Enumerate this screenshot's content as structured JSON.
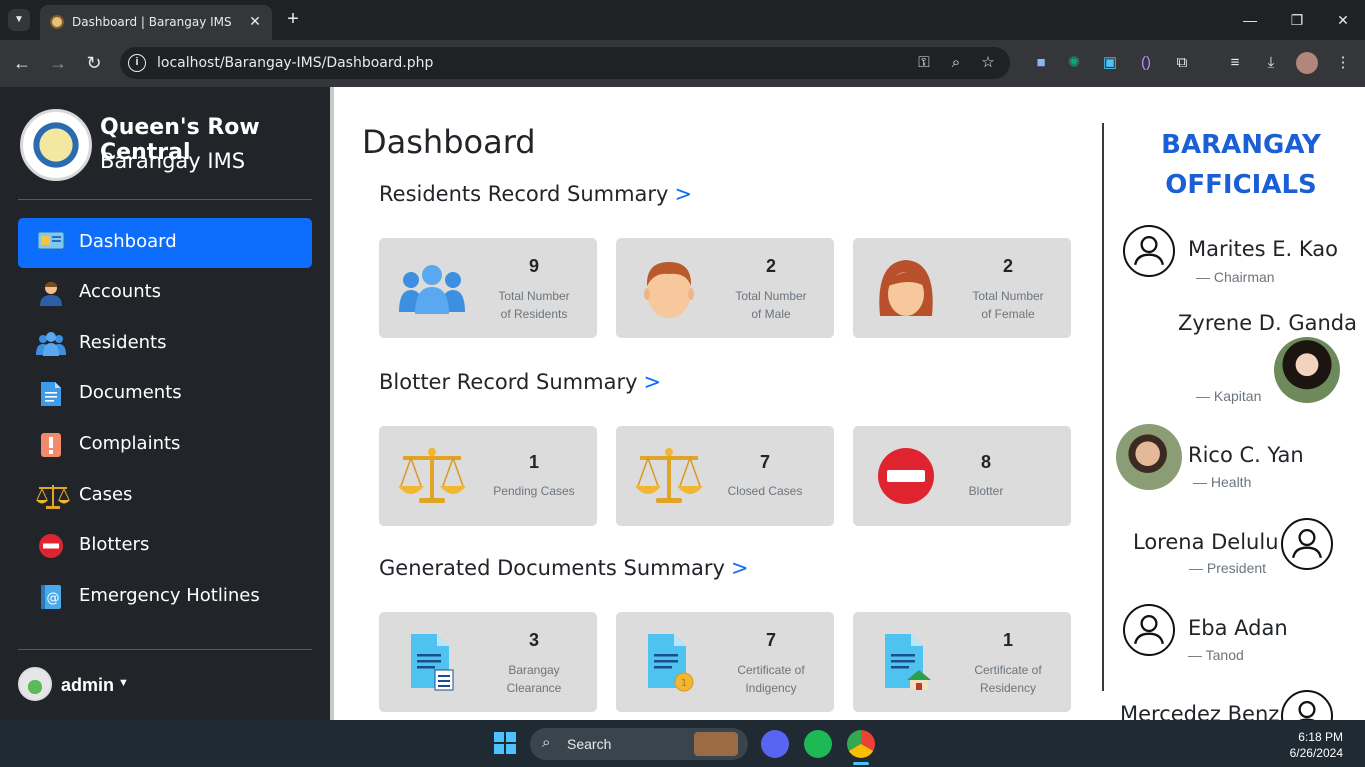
{
  "browser": {
    "tab_title": "Dashboard | Barangay IMS",
    "url": "localhost/Barangay-IMS/Dashboard.php"
  },
  "brand": {
    "title": "Queen's Row Central",
    "subtitle": "Barangay IMS"
  },
  "sidebar": {
    "items": [
      {
        "label": "Dashboard",
        "icon": "dashboard-icon",
        "active": true
      },
      {
        "label": "Accounts",
        "icon": "user-icon"
      },
      {
        "label": "Residents",
        "icon": "people-icon"
      },
      {
        "label": "Documents",
        "icon": "document-icon"
      },
      {
        "label": "Complaints",
        "icon": "exclamation-icon"
      },
      {
        "label": "Cases",
        "icon": "scales-icon"
      },
      {
        "label": "Blotters",
        "icon": "no-entry-icon"
      },
      {
        "label": "Emergency Hotlines",
        "icon": "contact-book-icon"
      }
    ],
    "user": "admin"
  },
  "main": {
    "title": "Dashboard",
    "sections": [
      {
        "title": "Residents Record Summary",
        "link": ">",
        "cards": [
          {
            "value": "9",
            "label_1": "Total Number",
            "label_2": "of Residents"
          },
          {
            "value": "2",
            "label_1": "Total Number",
            "label_2": "of Male"
          },
          {
            "value": "2",
            "label_1": "Total Number",
            "label_2": "of Female"
          }
        ]
      },
      {
        "title": "Blotter Record Summary",
        "link": ">",
        "cards": [
          {
            "value": "1",
            "label_1": "Pending Cases"
          },
          {
            "value": "7",
            "label_1": "Closed Cases"
          },
          {
            "value": "8",
            "label_1": "Blotter"
          }
        ]
      },
      {
        "title": "Generated Documents Summary",
        "link": ">",
        "cards": [
          {
            "value": "3",
            "label_1": "Barangay",
            "label_2": "Clearance"
          },
          {
            "value": "7",
            "label_1": "Certificate of",
            "label_2": "Indigency"
          },
          {
            "value": "1",
            "label_1": "Certificate of",
            "label_2": "Residency"
          }
        ]
      }
    ]
  },
  "officials": {
    "title_1": "BARANGAY",
    "title_2": "OFFICIALS",
    "list": [
      {
        "name": "Marites E. Kao",
        "role": "—  Chairman"
      },
      {
        "name": "Zyrene D. Ganda",
        "role": "—  Kapitan"
      },
      {
        "name": "Rico C. Yan",
        "role": "—  Health"
      },
      {
        "name": "Lorena Delulu",
        "role": "—  President"
      },
      {
        "name": "Eba Adan",
        "role": "—  Tanod"
      },
      {
        "name": "Mercedez Benz",
        "role": ""
      }
    ]
  },
  "taskbar": {
    "search": "Search",
    "time": "6:18 PM",
    "date": "6/26/2024"
  },
  "colors": {
    "accent": "#0d6efd",
    "sidebar_bg": "#212529",
    "card_bg": "#dcdcdc",
    "officials_title": "#1a5fd6"
  }
}
